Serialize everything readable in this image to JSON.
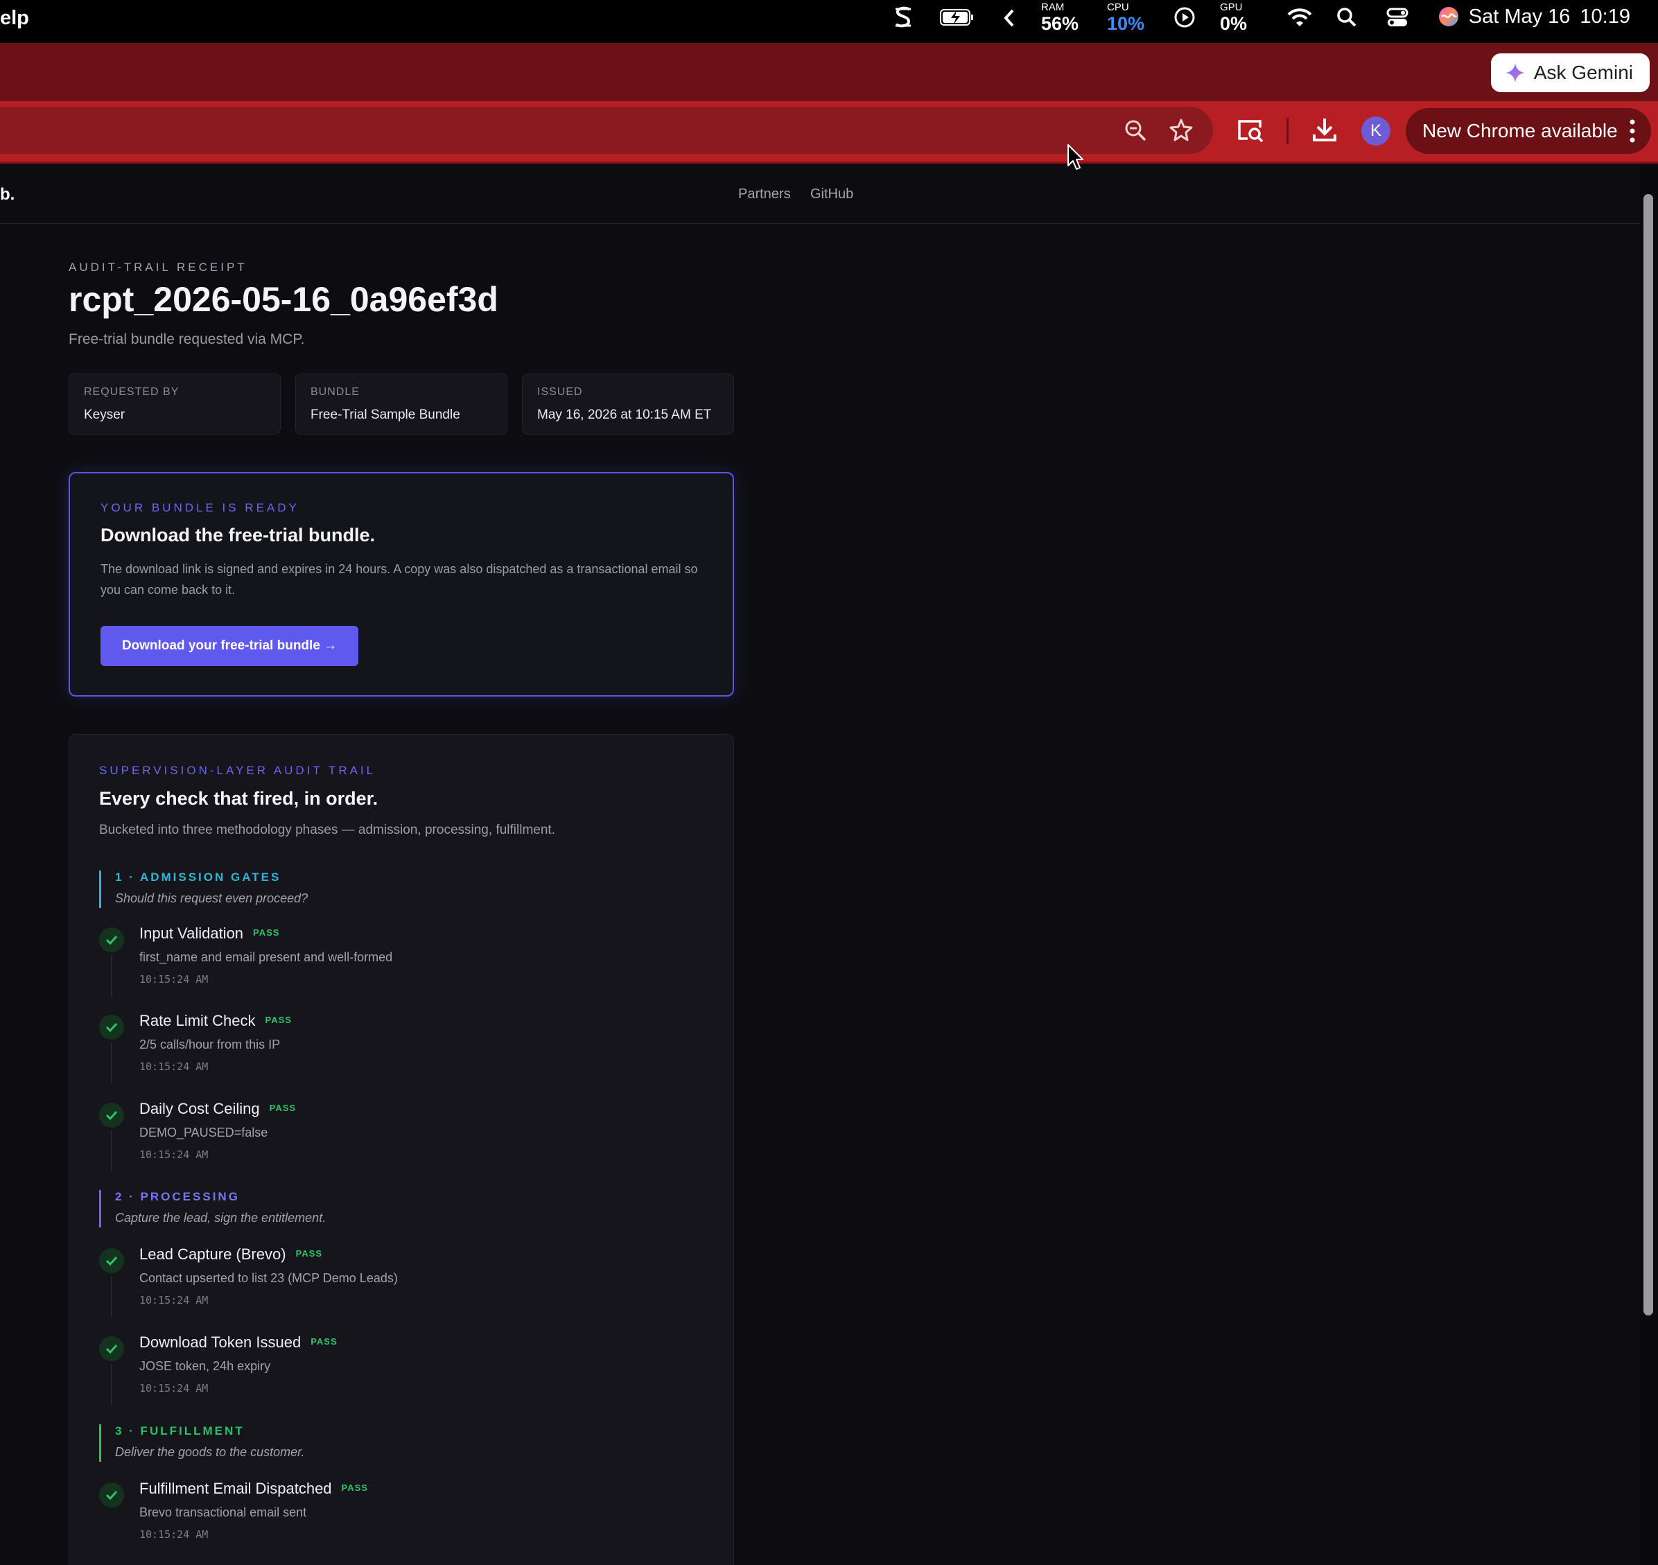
{
  "menubar": {
    "app_fragment": "elp",
    "ram": {
      "label": "RAM",
      "value": "56%"
    },
    "cpu": {
      "label": "CPU",
      "value": "10%"
    },
    "gpu": {
      "label": "GPU",
      "value": "0%"
    },
    "date": "Sat May 16",
    "time": "10:19"
  },
  "browser": {
    "ask_gemini_label": "Ask Gemini",
    "avatar_initial": "K",
    "new_chrome_label": "New Chrome available"
  },
  "site_nav": {
    "brand_fragment": "b.",
    "links": [
      "Partners",
      "GitHub"
    ]
  },
  "receipt": {
    "eyebrow": "AUDIT-TRAIL RECEIPT",
    "id": "rcpt_2026-05-16_0a96ef3d",
    "subtitle": "Free-trial bundle requested via MCP.",
    "meta": [
      {
        "key": "REQUESTED BY",
        "value": "Keyser"
      },
      {
        "key": "BUNDLE",
        "value": "Free-Trial Sample Bundle"
      },
      {
        "key": "ISSUED",
        "value": "May 16, 2026 at 10:15 AM ET"
      }
    ]
  },
  "bundle_ready": {
    "kicker": "YOUR BUNDLE IS READY",
    "title": "Download the free-trial bundle.",
    "body": "The download link is signed and expires in 24 hours. A copy was also dispatched as a transactional email so you can come back to it.",
    "button_label": "Download your free-trial bundle →"
  },
  "audit_trail": {
    "kicker": "SUPERVISION-LAYER AUDIT TRAIL",
    "title": "Every check that fired, in order.",
    "description": "Bucketed into three methodology phases — admission, processing, fulfillment.",
    "phases": [
      {
        "title": "1 · ADMISSION GATES",
        "description": "Should this request even proceed?",
        "checks": [
          {
            "name": "Input Validation",
            "status": "PASS",
            "detail": "first_name and email present and well-formed",
            "time": "10:15:24 AM"
          },
          {
            "name": "Rate Limit Check",
            "status": "PASS",
            "detail": "2/5 calls/hour from this IP",
            "time": "10:15:24 AM"
          },
          {
            "name": "Daily Cost Ceiling",
            "status": "PASS",
            "detail": "DEMO_PAUSED=false",
            "time": "10:15:24 AM"
          }
        ]
      },
      {
        "title": "2 · PROCESSING",
        "description": "Capture the lead, sign the entitlement.",
        "checks": [
          {
            "name": "Lead Capture (Brevo)",
            "status": "PASS",
            "detail": "Contact upserted to list 23 (MCP Demo Leads)",
            "time": "10:15:24 AM"
          },
          {
            "name": "Download Token Issued",
            "status": "PASS",
            "detail": "JOSE token, 24h expiry",
            "time": "10:15:24 AM"
          }
        ]
      },
      {
        "title": "3 · FULFILLMENT",
        "description": "Deliver the goods to the customer.",
        "checks": [
          {
            "name": "Fulfillment Email Dispatched",
            "status": "PASS",
            "detail": "Brevo transactional email sent",
            "time": "10:15:24 AM"
          }
        ]
      }
    ]
  },
  "colors": {
    "accent": "#5f59ee",
    "phase1": "#2fb6d6",
    "phase2": "#6e67f2",
    "phase3": "#28c364",
    "pass": "#2fc46a",
    "chrome_toolbar": "#b81f25"
  }
}
